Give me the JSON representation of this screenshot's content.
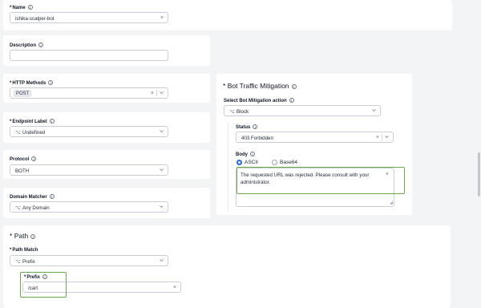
{
  "name": {
    "label": "Name",
    "value": "ishika-scalper-bot"
  },
  "description": {
    "label": "Description",
    "value": ""
  },
  "http_methods": {
    "label": "HTTP Methods",
    "chip": "POST"
  },
  "endpoint_label": {
    "label": "Endpoint Label",
    "value": "Undefined"
  },
  "protocol": {
    "label": "Protocol",
    "value": "BOTH"
  },
  "domain_matcher": {
    "label": "Domain Matcher",
    "value": "Any Domain"
  },
  "path": {
    "title": "Path",
    "path_match": {
      "label": "Path Match",
      "value": "Prefix"
    },
    "prefix": {
      "label": "Prefix",
      "value": "/cart"
    }
  },
  "bot_mitigation": {
    "title": "Bot Traffic Mitigation",
    "action": {
      "label": "Select Bot Mitigation action",
      "value": "Block"
    },
    "status": {
      "label": "Status",
      "value": "403 Forbidden"
    },
    "body": {
      "label": "Body",
      "option_ascii": "ASCII",
      "option_base64": "Base64",
      "selected": "ASCII",
      "value": "The requested URL was rejected. Please consult with your administrator."
    }
  },
  "icons": {
    "info": "info-circle-icon",
    "clear": "close-x-icon",
    "chevron": "chevron-down-icon",
    "select": "branch-select-icon"
  },
  "colors": {
    "highlight": "#6aa84f",
    "radio_selected": "#2563eb",
    "background": "#f3f4f6"
  }
}
